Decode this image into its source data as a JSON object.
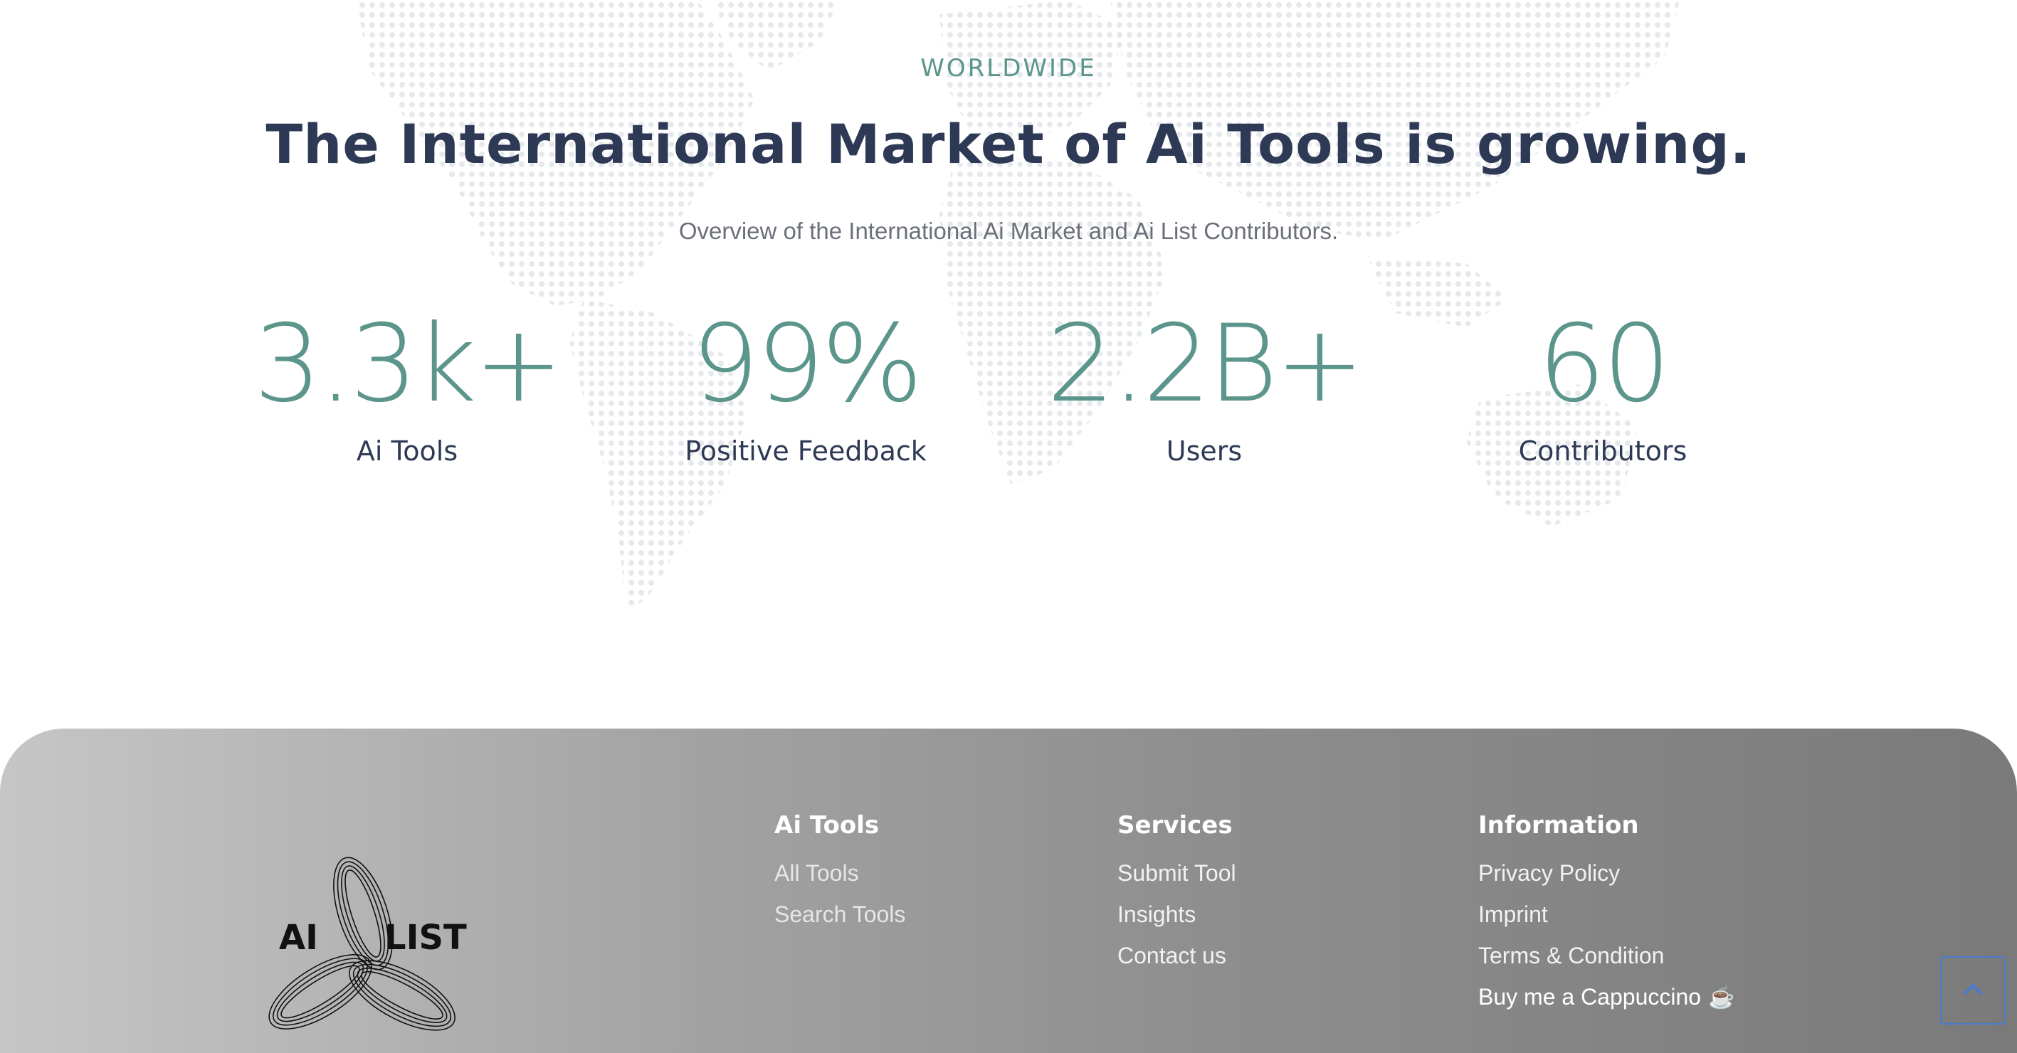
{
  "stats_section": {
    "eyebrow": "WORLDWIDE",
    "headline": "The International Market of Ai Tools is growing.",
    "subtitle": "Overview of the International Ai Market and Ai List Contributors.",
    "stats": [
      {
        "value": "3.3k+",
        "label": "Ai Tools"
      },
      {
        "value": "99%",
        "label": "Positive Feedback"
      },
      {
        "value": "2.2B+",
        "label": "Users"
      },
      {
        "value": "60",
        "label": "Contributors"
      }
    ]
  },
  "footer": {
    "logo_text_left": "AI",
    "logo_text_right": "LIST",
    "columns": [
      {
        "heading": "Ai Tools",
        "links": [
          "All Tools",
          "Search Tools"
        ]
      },
      {
        "heading": "Services",
        "links": [
          "Submit Tool",
          "Insights",
          "Contact us"
        ]
      },
      {
        "heading": "Information",
        "links": [
          "Privacy Policy",
          "Imprint",
          "Terms & Condition",
          "Buy me a Cappuccino"
        ]
      }
    ],
    "cappuccino_icon": "☕",
    "back_to_top_icon": "chevron-up-icon"
  },
  "colors": {
    "accent": "#5b958b",
    "heading": "#2e3a55",
    "back_to_top_border": "#4a7bd0"
  }
}
